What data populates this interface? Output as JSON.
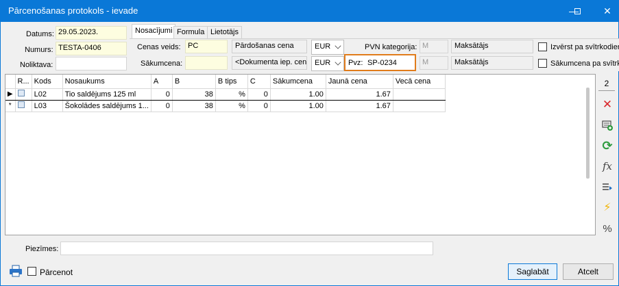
{
  "window": {
    "title": "Pārcenošanas protokols - ievade",
    "minimize_glyph": "—",
    "maximize_glyph": "☐",
    "close_glyph": "✕"
  },
  "header": {
    "date_label": "Datums:",
    "date_value": "29.05.2023.",
    "number_label": "Numurs:",
    "number_value": "TESTA-0406",
    "warehouse_label": "Noliktava:",
    "warehouse_value": ""
  },
  "tabs": [
    {
      "label": "Nosacījumi",
      "active": true
    },
    {
      "label": "Formula",
      "active": false
    },
    {
      "label": "Lietotājs",
      "active": false
    }
  ],
  "conditions": {
    "price_type_label": "Cenas veids:",
    "price_type_value": "PC",
    "price_type_desc": "Pārdošanas cena",
    "currency1": "EUR",
    "start_price_label": "Sākumcena:",
    "start_price_value": "",
    "start_price_desc": "<Dokumenta iep. cena>",
    "currency2": "EUR",
    "vat_category_label": "PVN kategorija:",
    "vat_code1": "M",
    "payer1": "Maksātājs",
    "pvz_label": "Pvz:",
    "pvz_value": "SP-0234",
    "vat_code2": "M",
    "payer2": "Maksātājs",
    "expand_barcode_label": "Izvērst pa svītrkodiem",
    "start_price_barcode_label": "Sākumcena pa svītrkodiem"
  },
  "grid": {
    "columns": [
      "R...",
      "Kods",
      "Nosaukums",
      "A",
      "B",
      "B tips",
      "C",
      "Sākumcena",
      "Jaunā cena",
      "Vecā cena"
    ],
    "rows": [
      {
        "indicator": "▶",
        "code": "L02",
        "name": "Tio saldējums 125 ml",
        "a": "0",
        "b": "38",
        "b_type": "%",
        "c": "0",
        "start_price": "1.00",
        "new_price": "1.67",
        "old_price": ""
      },
      {
        "indicator": "*",
        "code": "L03",
        "name": "Šokolādes saldējums 1...",
        "a": "0",
        "b": "38",
        "b_type": "%",
        "c": "0",
        "start_price": "1.00",
        "new_price": "1.67",
        "old_price": ""
      }
    ]
  },
  "side": {
    "count": "2",
    "fx_label": "fx",
    "percent_label": "%"
  },
  "notes": {
    "label": "Piezīmes:",
    "value": ""
  },
  "footer": {
    "reprice_label": "Pārcenot",
    "save_label": "Saglabāt",
    "cancel_label": "Atcelt"
  },
  "colors": {
    "titlebar": "#0a78d7",
    "highlight_box": "#e07b1a",
    "delete": "#d9262b",
    "refresh": "#2e9b3f"
  }
}
